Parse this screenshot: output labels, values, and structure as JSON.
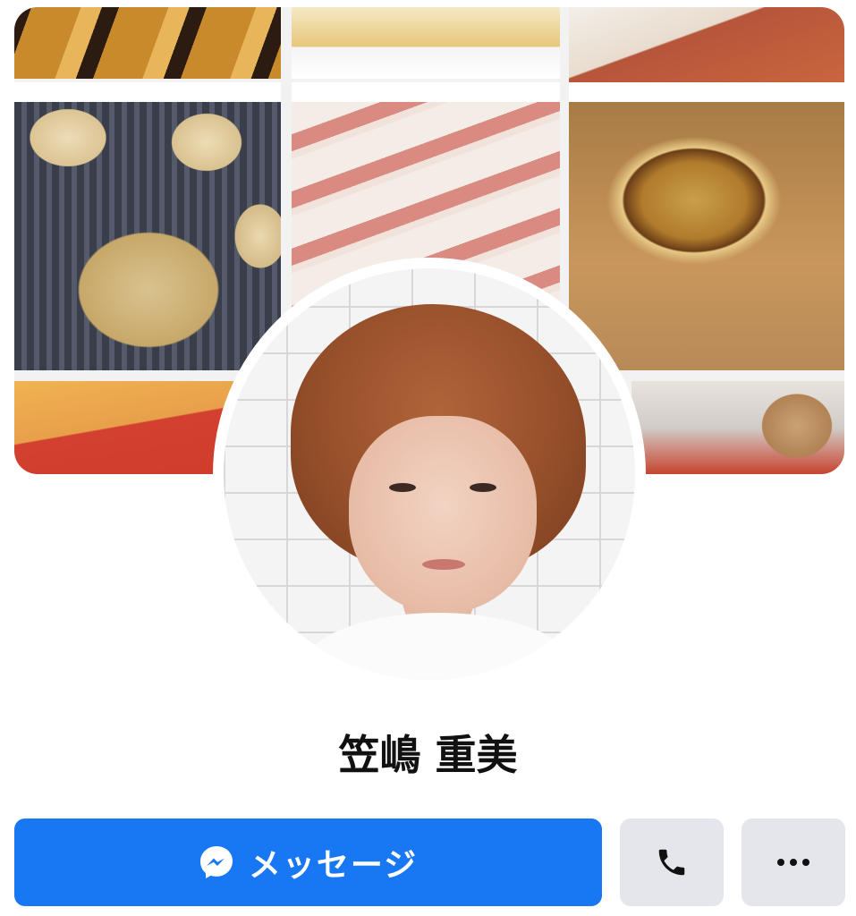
{
  "profile": {
    "name": "笠嶋 重美"
  },
  "actions": {
    "message_label": "メッセージ",
    "call_icon": "phone-icon",
    "more_icon": "more-dots-icon"
  },
  "colors": {
    "primary": "#1877f2",
    "secondary_button": "#e4e6eb",
    "name_text": "#111111"
  }
}
